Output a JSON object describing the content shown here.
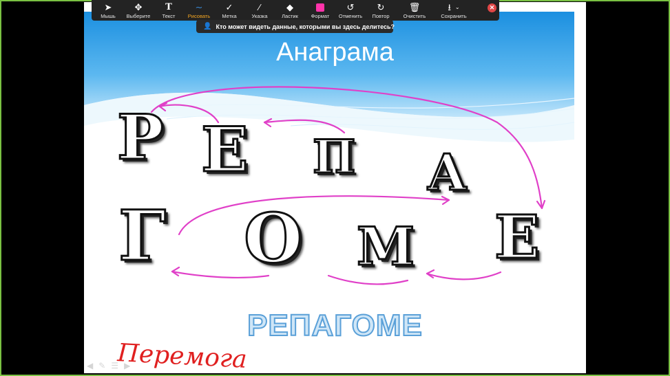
{
  "toolbar": {
    "tools": [
      {
        "label": "Мышь",
        "icon": "cursor-icon"
      },
      {
        "label": "Выберите",
        "icon": "move-icon"
      },
      {
        "label": "Текст",
        "icon": "text-icon"
      },
      {
        "label": "Рисовать",
        "icon": "draw-icon"
      },
      {
        "label": "Метка",
        "icon": "checkmark-icon"
      },
      {
        "label": "Указка",
        "icon": "pointer-icon"
      },
      {
        "label": "Ластик",
        "icon": "eraser-icon"
      },
      {
        "label": "Формат",
        "icon": "format-icon"
      },
      {
        "label": "Отменить",
        "icon": "undo-icon"
      },
      {
        "label": "Повтор",
        "icon": "redo-icon"
      },
      {
        "label": "Очистить",
        "icon": "trash-icon"
      },
      {
        "label": "Сохранить",
        "icon": "save-icon"
      }
    ],
    "active_tool": "Рисовать",
    "format_color": "#ff33aa"
  },
  "banner": {
    "text": "Кто может видеть данные, которыми вы здесь делитесь?"
  },
  "slide": {
    "title": "Анаграма",
    "letters_top": [
      "Р",
      "Е",
      "П",
      "А"
    ],
    "letters_bottom": [
      "Г",
      "О",
      "М",
      "Е"
    ],
    "answer": "РЕПАГОМЕ",
    "handwriting": "Перемога",
    "ink_color": "#e040c8"
  }
}
